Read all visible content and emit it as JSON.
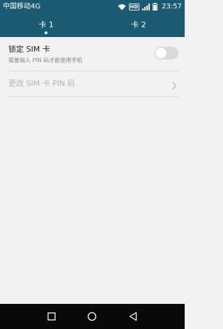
{
  "status_bar": {
    "carrier": "中国移动4G",
    "hd_badge": "HD",
    "network_badge": "4G",
    "time": "23:57",
    "icons": [
      "wifi-icon",
      "hd-icon",
      "signal-icon",
      "battery-icon"
    ]
  },
  "tabs": [
    {
      "label": "卡 1",
      "selected": true
    },
    {
      "label": "卡 2",
      "selected": false
    }
  ],
  "settings": {
    "lock_sim": {
      "title": "锁定 SIM 卡",
      "subtitle": "需要输入 PIN 码才能使用手机",
      "enabled": false
    },
    "change_pin": {
      "label": "更改 SIM 卡 PIN 码",
      "enabled": false,
      "icon": "chevron-right-icon"
    }
  },
  "nav_bar": {
    "icons": [
      "recents-icon",
      "home-icon",
      "back-icon"
    ]
  },
  "colors": {
    "header": "#1c5a74",
    "background": "#f2f2f2",
    "navbar": "#0a0a0a",
    "toggle_off": "#d9d9d9"
  }
}
